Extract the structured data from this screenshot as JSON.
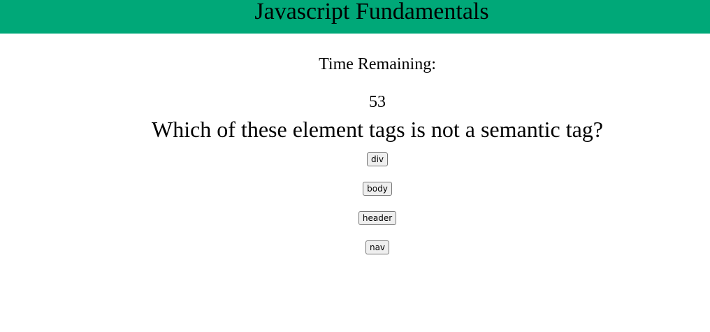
{
  "header": {
    "title": "Javascript Fundamentals"
  },
  "timer": {
    "label": "Time Remaining:",
    "value": "53"
  },
  "quiz": {
    "question": "Which of these element tags is not a semantic tag?",
    "answers": [
      "div",
      "body",
      "header",
      "nav"
    ]
  },
  "colors": {
    "header_background": "#00a878",
    "page_background": "#ffffff"
  }
}
